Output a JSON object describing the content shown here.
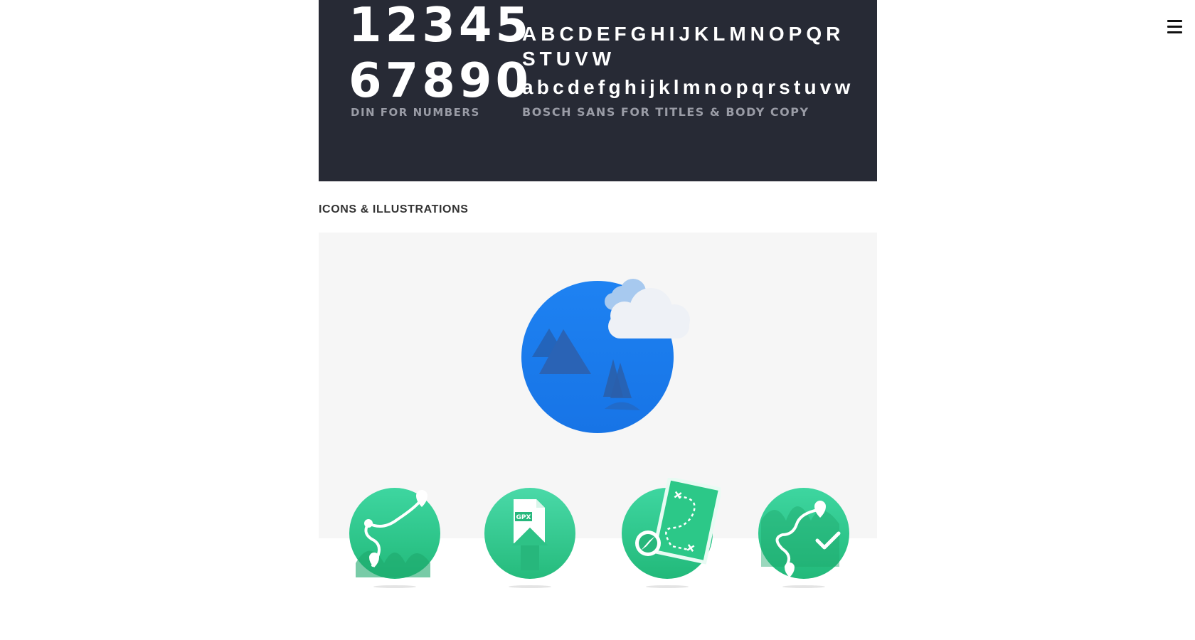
{
  "nav": {
    "menu_icon": "hamburger-menu-icon"
  },
  "typography": {
    "numbers_line1": "12345",
    "numbers_line2": "67890",
    "numbers_caption": "DIN FOR NUMBERS",
    "uppercase": "ABCDEFGHIJKLMNOPQR STUVW",
    "lowercase": "abcdefghijklmnopqrstuvw",
    "font_caption": "BOSCH SANS FOR TITLES & BODY COPY"
  },
  "icons_section": {
    "title": "ICONS & ILLUSTRATIONS",
    "gpx_label": "GPX",
    "hero": "landscape-illustration-icon",
    "icons": [
      "route-map-icon",
      "gpx-file-upload-icon",
      "treasure-map-compass-icon",
      "route-checkpoint-icon"
    ]
  },
  "colors": {
    "dark_panel": "#272a35",
    "caption_gray": "#9a9ca6",
    "brand_blue": "#1b7ff0",
    "brand_green": "#2fcf92",
    "panel_gray": "#f6f6f6"
  }
}
